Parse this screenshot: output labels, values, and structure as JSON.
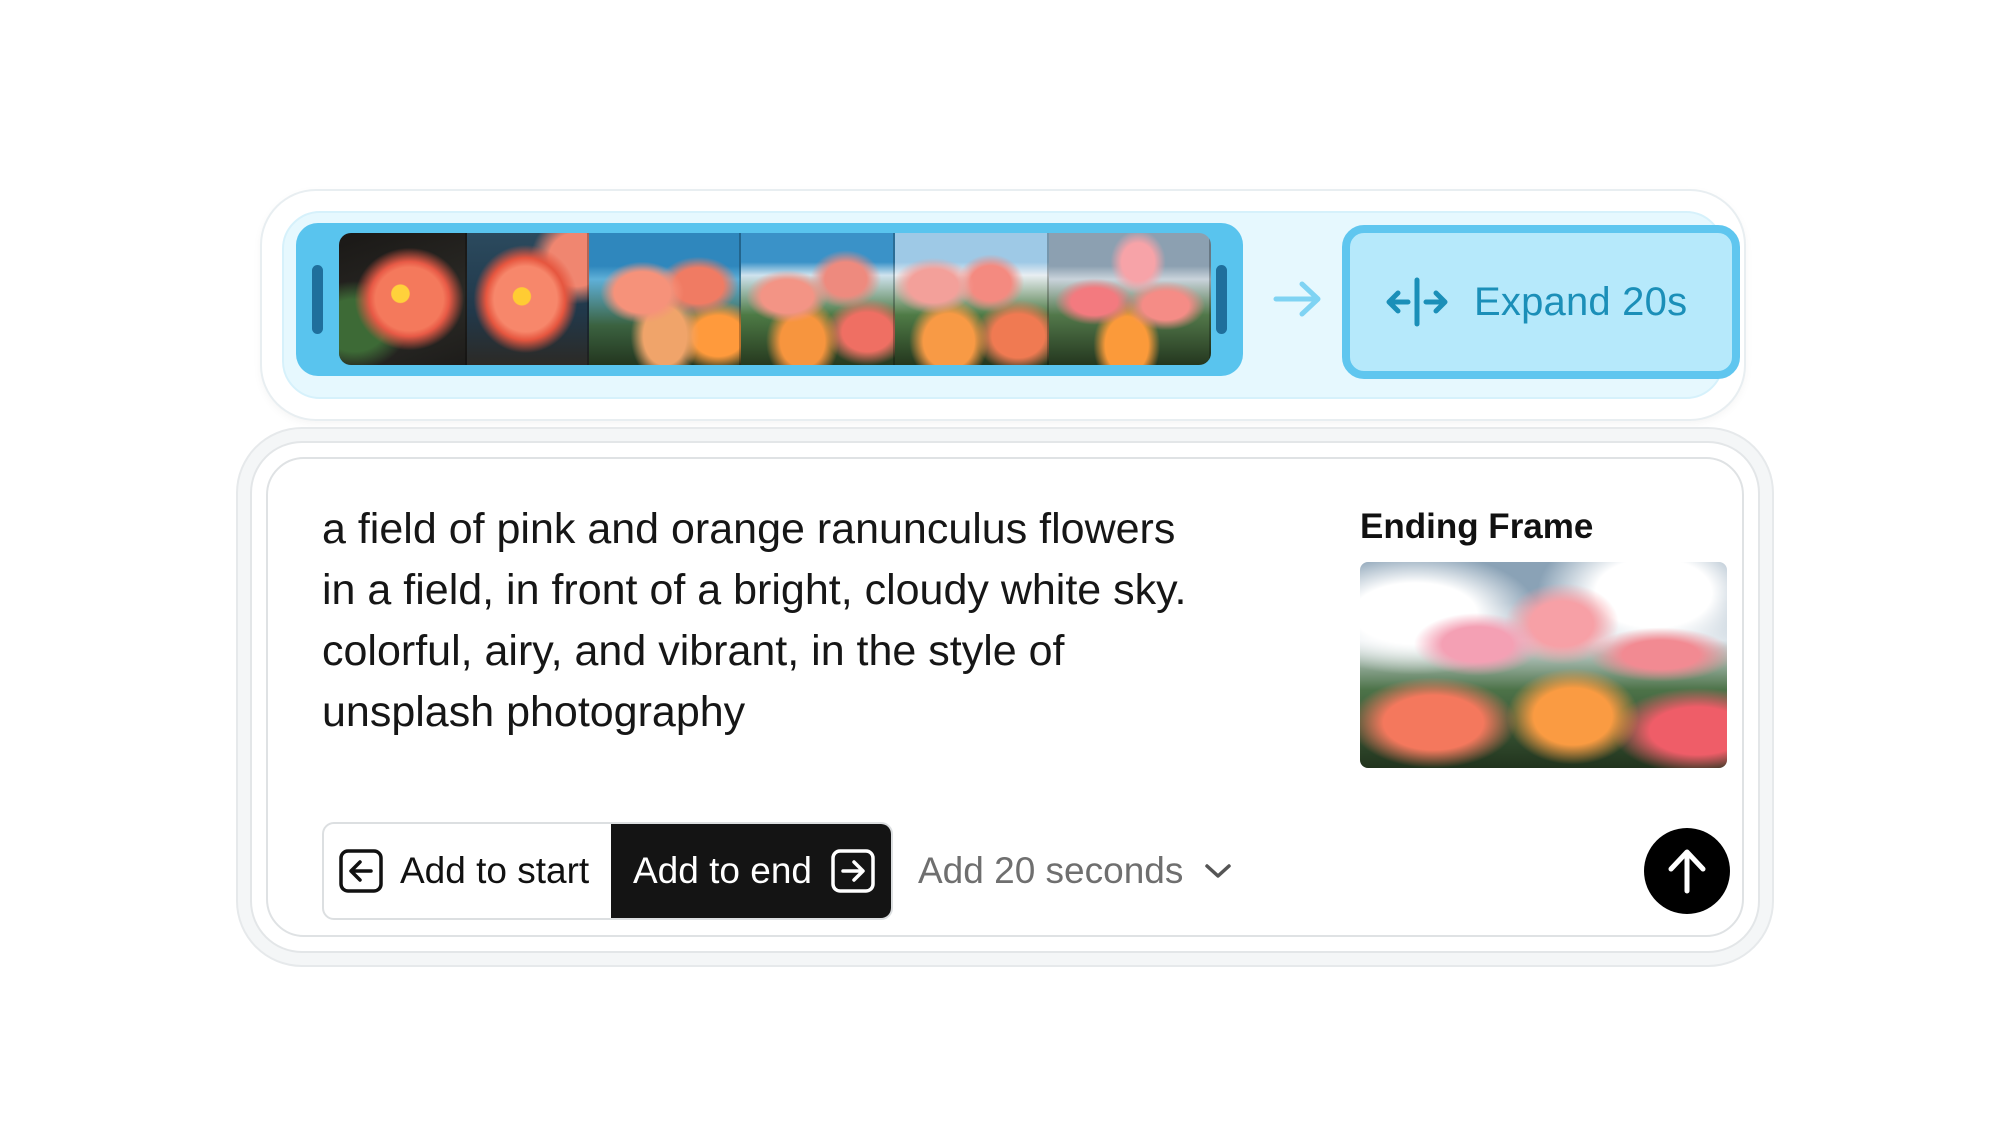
{
  "timeline": {
    "frames": [
      "frame-1",
      "frame-2",
      "frame-3",
      "frame-4",
      "frame-5",
      "frame-6"
    ],
    "expand_label": "Expand 20s",
    "accent": "#5fc6ef",
    "expand_text_color": "#1b8fb8"
  },
  "prompt": {
    "text": "a field of pink and orange ranunculus flowers\nin a field, in front of a bright, cloudy white sky.\ncolorful, airy, and vibrant, in the style of\nunsplash photography",
    "ending_frame_label": "Ending Frame"
  },
  "controls": {
    "add_to_start_label": "Add to start",
    "add_to_end_label": "Add to end",
    "duration_label": "Add 20 seconds"
  },
  "icons": {
    "arrow": "arrow-right-icon",
    "expand": "expand-horizontal-icon",
    "add_start": "arrow-left-box-icon",
    "add_end": "arrow-right-box-icon",
    "chevron": "chevron-down-icon",
    "submit": "arrow-up-icon"
  }
}
